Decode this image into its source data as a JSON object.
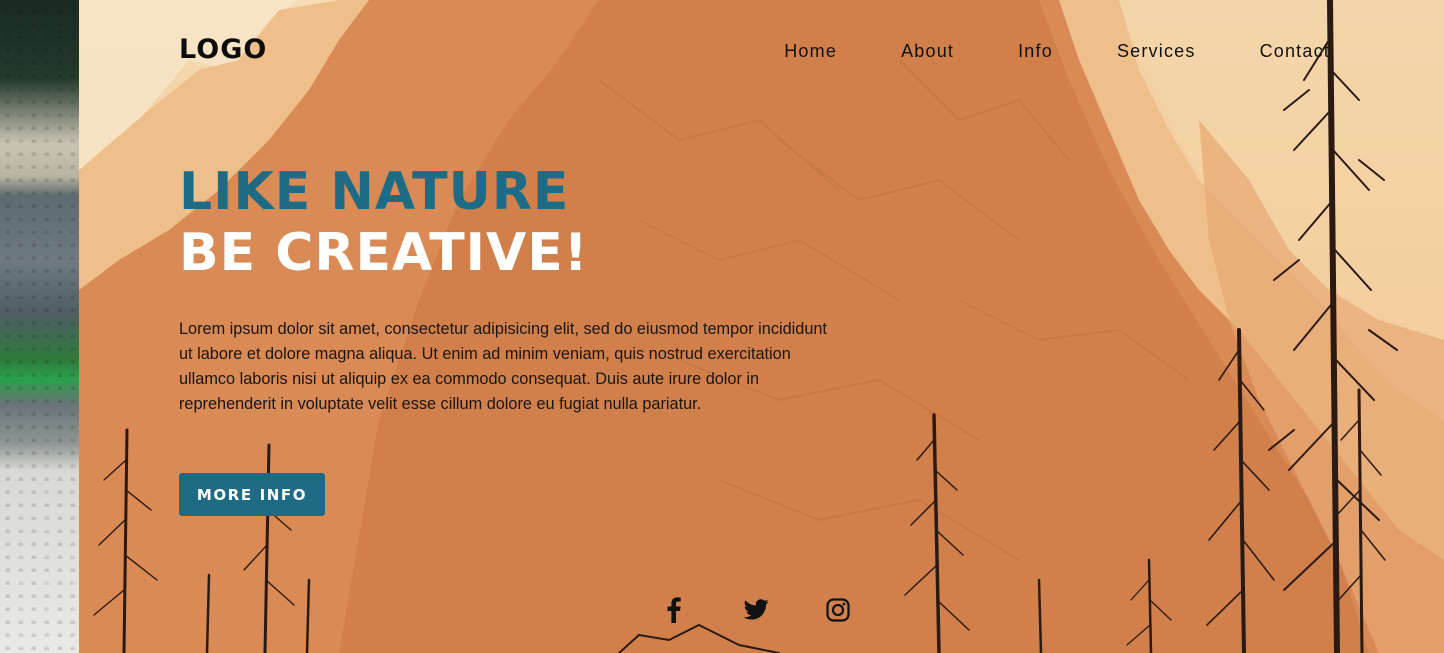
{
  "brand": {
    "logo_text": "LOGO"
  },
  "nav": {
    "items": [
      {
        "label": "Home"
      },
      {
        "label": "About"
      },
      {
        "label": "Info"
      },
      {
        "label": "Services"
      },
      {
        "label": "Contact"
      }
    ]
  },
  "hero": {
    "headline_primary": "LIKE NATURE",
    "headline_secondary": "BE CREATIVE!",
    "body": "Lorem ipsum dolor sit amet, consectetur adipisicing elit, sed do eiusmod tempor incididunt ut labore et dolore magna aliqua. Ut enim ad minim veniam, quis nostrud exercitation ullamco laboris nisi ut aliquip ex ea commodo consequat. Duis aute irure dolor in reprehenderit in voluptate velit esse cillum dolore eu fugiat nulla pariatur.",
    "cta_label": "MORE INFO"
  },
  "social": {
    "icons": [
      "facebook-icon",
      "twitter-icon",
      "instagram-icon"
    ]
  },
  "colors": {
    "accent": "#1f6b84",
    "headline_primary": "#1e6b85",
    "headline_secondary": "#ffffff",
    "text": "#1a1512"
  }
}
